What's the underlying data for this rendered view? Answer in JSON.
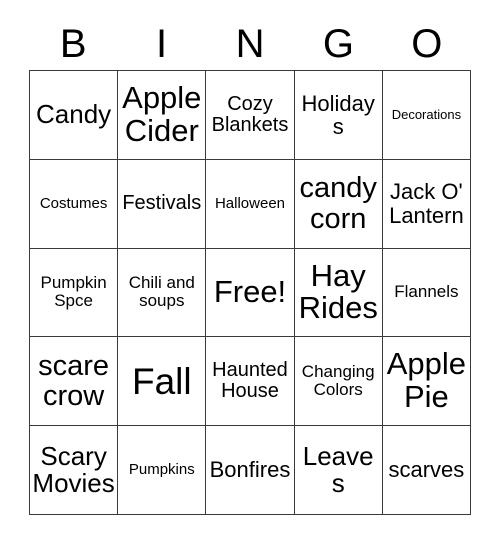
{
  "card": {
    "title_letters": [
      "B",
      "I",
      "N",
      "G",
      "O"
    ],
    "rows": [
      [
        {
          "label": "Candy",
          "size": "fs-2xl"
        },
        {
          "label": "Apple Cider",
          "size": "fs-4xl"
        },
        {
          "label": "Cozy Blankets",
          "size": "fs-lg"
        },
        {
          "label": "Holidays",
          "size": "fs-xl"
        },
        {
          "label": "Decorations",
          "size": "fs-xs"
        }
      ],
      [
        {
          "label": "Costumes",
          "size": "fs-sm"
        },
        {
          "label": "Festivals",
          "size": "fs-lg"
        },
        {
          "label": "Halloween",
          "size": "fs-sm"
        },
        {
          "label": "candy corn",
          "size": "fs-3xl"
        },
        {
          "label": "Jack O' Lantern",
          "size": "fs-xl"
        }
      ],
      [
        {
          "label": "Pumpkin Spce",
          "size": "fs-md"
        },
        {
          "label": "Chili and soups",
          "size": "fs-md"
        },
        {
          "label": "Free!",
          "size": "fs-4xl"
        },
        {
          "label": "Hay Rides",
          "size": "fs-4xl"
        },
        {
          "label": "Flannels",
          "size": "fs-md"
        }
      ],
      [
        {
          "label": "scare crow",
          "size": "fs-3xl"
        },
        {
          "label": "Fall",
          "size": "fs-5xl"
        },
        {
          "label": "Haunted House",
          "size": "fs-lg"
        },
        {
          "label": "Changing Colors",
          "size": "fs-md"
        },
        {
          "label": "Apple Pie",
          "size": "fs-4xl"
        }
      ],
      [
        {
          "label": "Scary Movies",
          "size": "fs-2xl"
        },
        {
          "label": "Pumpkins",
          "size": "fs-sm"
        },
        {
          "label": "Bonfires",
          "size": "fs-xl"
        },
        {
          "label": "Leaves",
          "size": "fs-2xl"
        },
        {
          "label": "scarves",
          "size": "fs-xl"
        }
      ]
    ],
    "colors": {
      "border": "#3a3a3a",
      "background": "#ffffff",
      "text": "#000000"
    }
  }
}
